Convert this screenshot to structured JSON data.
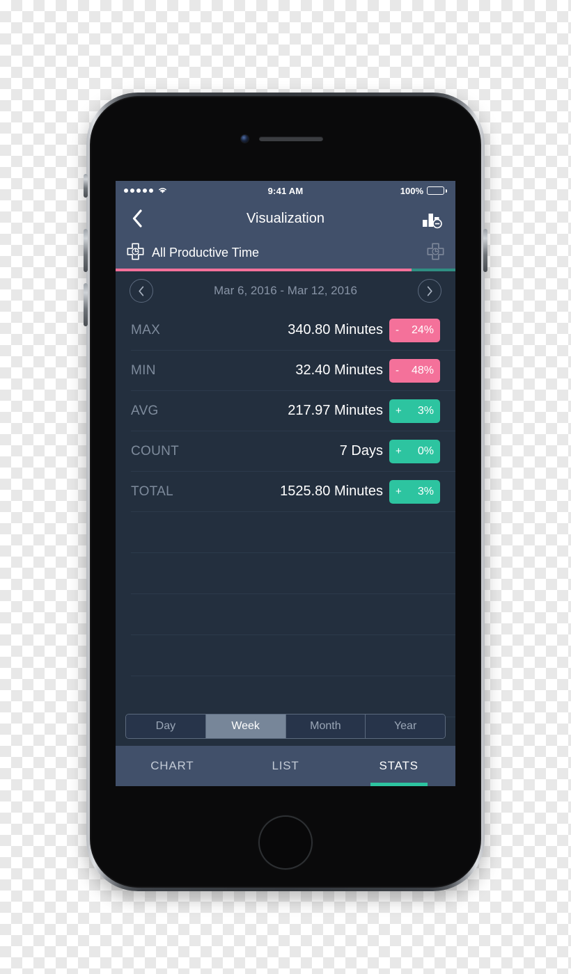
{
  "status_bar": {
    "signal_dots": 5,
    "wifi_icon": "wifi-icon",
    "time": "9:41 AM",
    "battery_percent": "100%",
    "battery_level": 100
  },
  "nav_bar": {
    "back_icon": "chevron-left-icon",
    "title": "Visualization",
    "chart_toggle_icon": "bar-chart-minus-icon"
  },
  "category": {
    "icon": "cross-clock-icon",
    "label": "All Productive Time",
    "add_icon": "cross-clock-icon",
    "progress_percent": 87,
    "progress_color": "#f4719a",
    "progress_track_color": "#2f8f83"
  },
  "date_nav": {
    "prev_icon": "chevron-left-circle-icon",
    "next_icon": "chevron-right-circle-icon",
    "range": "Mar 6, 2016 - Mar 12, 2016"
  },
  "stats": {
    "rows": [
      {
        "label": "MAX",
        "value": "340.80 Minutes",
        "sign": "-",
        "delta": "24%",
        "direction": "down"
      },
      {
        "label": "MIN",
        "value": "32.40 Minutes",
        "sign": "-",
        "delta": "48%",
        "direction": "down"
      },
      {
        "label": "AVG",
        "value": "217.97 Minutes",
        "sign": "+",
        "delta": "3%",
        "direction": "up"
      },
      {
        "label": "COUNT",
        "value": "7 Days",
        "sign": "+",
        "delta": "0%",
        "direction": "up"
      },
      {
        "label": "TOTAL",
        "value": "1525.80 Minutes",
        "sign": "+",
        "delta": "3%",
        "direction": "up"
      }
    ],
    "empty_row_count": 5
  },
  "segmented": {
    "items": [
      {
        "label": "Day",
        "selected": false
      },
      {
        "label": "Week",
        "selected": true
      },
      {
        "label": "Month",
        "selected": false
      },
      {
        "label": "Year",
        "selected": false
      }
    ]
  },
  "tab_bar": {
    "tabs": [
      {
        "label": "CHART",
        "active": false
      },
      {
        "label": "LIST",
        "active": false
      },
      {
        "label": "STATS",
        "active": true
      }
    ],
    "active_indicator_color": "#2dc4a0"
  },
  "colors": {
    "screen_background": "#232f3e",
    "chrome": "#41506a",
    "accent_negative": "#f4719a",
    "accent_positive": "#2dc4a0",
    "muted_text": "#7e8b9c",
    "separator": "#2c3a4b"
  }
}
